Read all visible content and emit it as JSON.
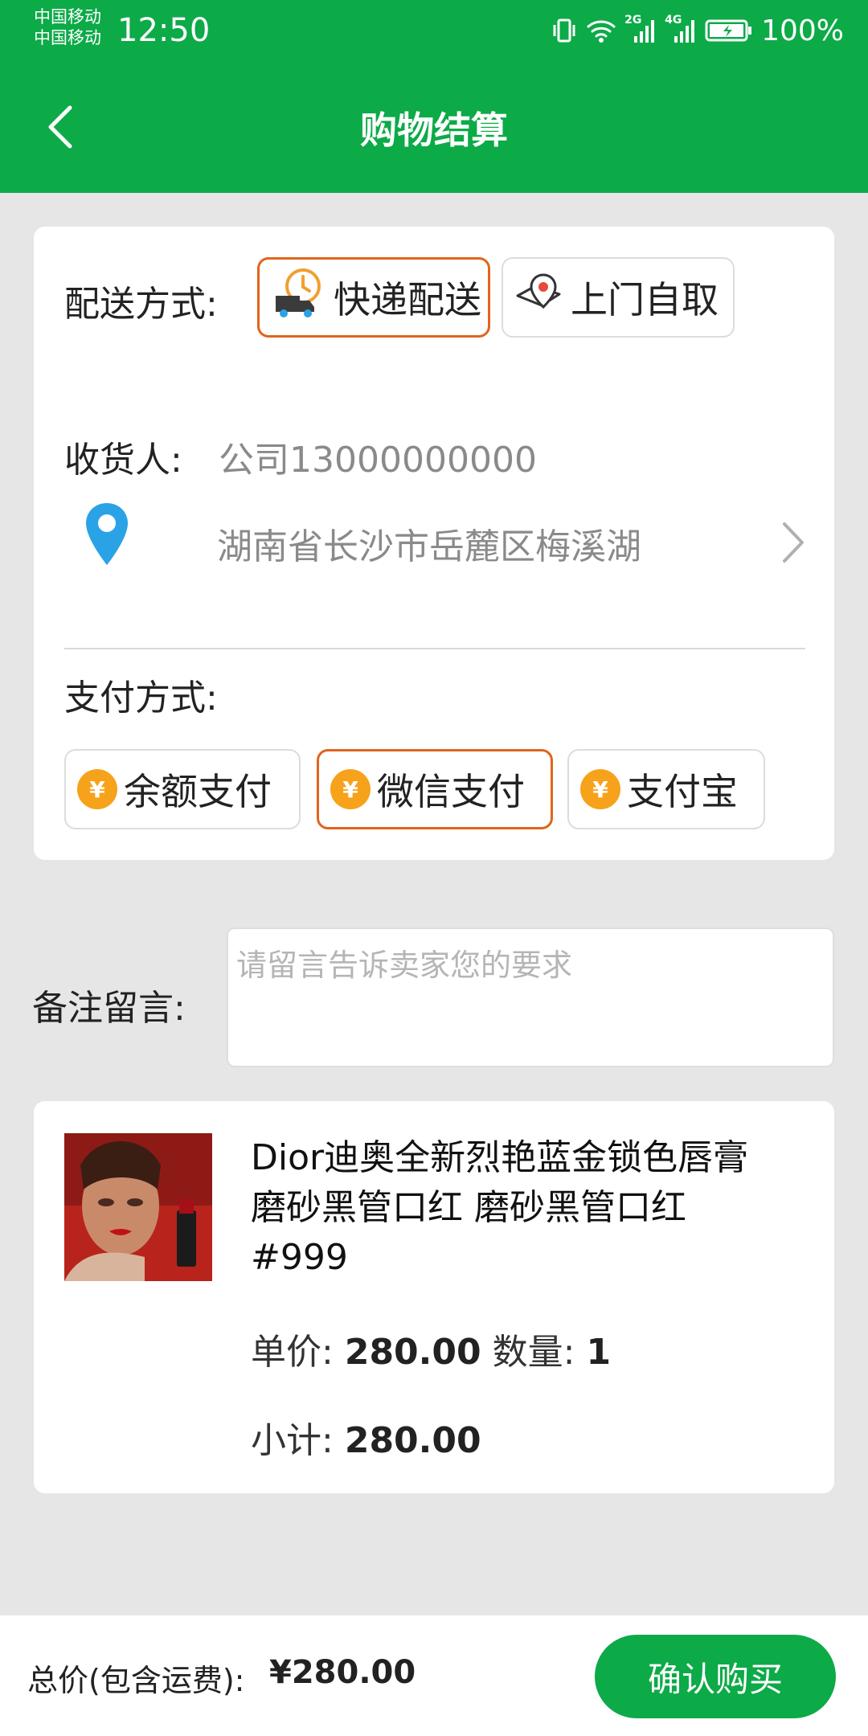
{
  "status_bar": {
    "carrier_1": "中国移动",
    "carrier_2": "中国移动",
    "time": "12:50",
    "network_1": "2G",
    "network_2": "4G",
    "battery": "100%"
  },
  "header": {
    "title": "购物结算"
  },
  "delivery": {
    "label": "配送方式:",
    "options": [
      {
        "label": "快递配送",
        "selected": true,
        "icon": "delivery-truck-icon"
      },
      {
        "label": "上门自取",
        "selected": false,
        "icon": "map-pin-icon"
      }
    ]
  },
  "receiver": {
    "label": "收货人:",
    "value": "公司13000000000",
    "address": "湖南省长沙市岳麓区梅溪湖"
  },
  "payment": {
    "label": "支付方式:",
    "options": [
      {
        "label": "余额支付",
        "selected": false,
        "icon": "yuan-coin-icon"
      },
      {
        "label": "微信支付",
        "selected": true,
        "icon": "yuan-coin-icon"
      },
      {
        "label": "支付宝",
        "selected": false,
        "icon": "yuan-coin-icon"
      }
    ],
    "coin_symbol": "¥"
  },
  "remark": {
    "label": "备注留言:",
    "placeholder": "请留言告诉卖家您的要求",
    "value": ""
  },
  "goods": {
    "name": "Dior迪奥全新烈艳蓝金锁色唇膏磨砂黑管口红 磨砂黑管口红#999",
    "unit_price_label": "单价:",
    "unit_price": "280.00",
    "qty_label": "数量:",
    "qty": "1",
    "subtotal_label": "小计:",
    "subtotal": "280.00"
  },
  "footer": {
    "total_label": "总价(包含运费):",
    "total_value": "¥280.00",
    "confirm_label": "确认购买"
  },
  "colors": {
    "brand_green": "#0daa48",
    "selected_border": "#e0651c",
    "coin_orange": "#f7a21b",
    "location_blue": "#2aa3e6"
  }
}
